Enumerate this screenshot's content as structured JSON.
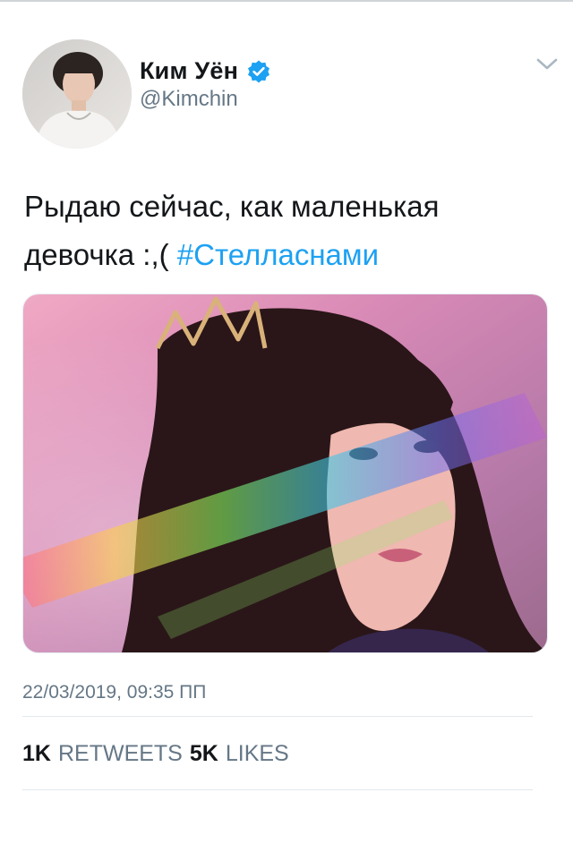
{
  "tweet": {
    "user": {
      "display_name": "Ким Уён",
      "handle": "@Kimchin",
      "verified_color": "#1da1f2"
    },
    "text_main": "Рыдаю сейчас, как маленькая девочка :,( ",
    "hashtag": "#Стелласнами",
    "timestamp": "22/03/2019, 09:35 ПП",
    "stats": {
      "retweets_count": "1K",
      "retweets_label": "RETWEETS",
      "likes_count": "5K",
      "likes_label": "LIKES"
    },
    "colors": {
      "link": "#1da1f2",
      "secondary_text": "#657786",
      "primary_text": "#14171a"
    }
  }
}
